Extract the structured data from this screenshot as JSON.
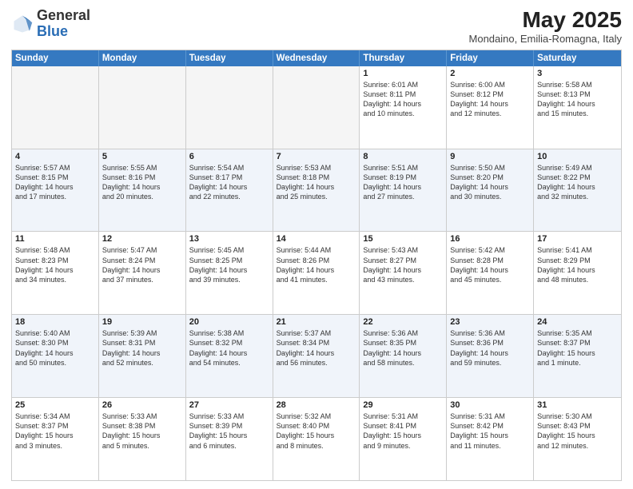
{
  "header": {
    "logo_general": "General",
    "logo_blue": "Blue",
    "month_title": "May 2025",
    "location": "Mondaino, Emilia-Romagna, Italy"
  },
  "days_of_week": [
    "Sunday",
    "Monday",
    "Tuesday",
    "Wednesday",
    "Thursday",
    "Friday",
    "Saturday"
  ],
  "rows": [
    {
      "alt": false,
      "cells": [
        {
          "day": "",
          "text": "",
          "empty": true
        },
        {
          "day": "",
          "text": "",
          "empty": true
        },
        {
          "day": "",
          "text": "",
          "empty": true
        },
        {
          "day": "",
          "text": "",
          "empty": true
        },
        {
          "day": "1",
          "text": "Sunrise: 6:01 AM\nSunset: 8:11 PM\nDaylight: 14 hours\nand 10 minutes.",
          "empty": false
        },
        {
          "day": "2",
          "text": "Sunrise: 6:00 AM\nSunset: 8:12 PM\nDaylight: 14 hours\nand 12 minutes.",
          "empty": false
        },
        {
          "day": "3",
          "text": "Sunrise: 5:58 AM\nSunset: 8:13 PM\nDaylight: 14 hours\nand 15 minutes.",
          "empty": false
        }
      ]
    },
    {
      "alt": true,
      "cells": [
        {
          "day": "4",
          "text": "Sunrise: 5:57 AM\nSunset: 8:15 PM\nDaylight: 14 hours\nand 17 minutes.",
          "empty": false
        },
        {
          "day": "5",
          "text": "Sunrise: 5:55 AM\nSunset: 8:16 PM\nDaylight: 14 hours\nand 20 minutes.",
          "empty": false
        },
        {
          "day": "6",
          "text": "Sunrise: 5:54 AM\nSunset: 8:17 PM\nDaylight: 14 hours\nand 22 minutes.",
          "empty": false
        },
        {
          "day": "7",
          "text": "Sunrise: 5:53 AM\nSunset: 8:18 PM\nDaylight: 14 hours\nand 25 minutes.",
          "empty": false
        },
        {
          "day": "8",
          "text": "Sunrise: 5:51 AM\nSunset: 8:19 PM\nDaylight: 14 hours\nand 27 minutes.",
          "empty": false
        },
        {
          "day": "9",
          "text": "Sunrise: 5:50 AM\nSunset: 8:20 PM\nDaylight: 14 hours\nand 30 minutes.",
          "empty": false
        },
        {
          "day": "10",
          "text": "Sunrise: 5:49 AM\nSunset: 8:22 PM\nDaylight: 14 hours\nand 32 minutes.",
          "empty": false
        }
      ]
    },
    {
      "alt": false,
      "cells": [
        {
          "day": "11",
          "text": "Sunrise: 5:48 AM\nSunset: 8:23 PM\nDaylight: 14 hours\nand 34 minutes.",
          "empty": false
        },
        {
          "day": "12",
          "text": "Sunrise: 5:47 AM\nSunset: 8:24 PM\nDaylight: 14 hours\nand 37 minutes.",
          "empty": false
        },
        {
          "day": "13",
          "text": "Sunrise: 5:45 AM\nSunset: 8:25 PM\nDaylight: 14 hours\nand 39 minutes.",
          "empty": false
        },
        {
          "day": "14",
          "text": "Sunrise: 5:44 AM\nSunset: 8:26 PM\nDaylight: 14 hours\nand 41 minutes.",
          "empty": false
        },
        {
          "day": "15",
          "text": "Sunrise: 5:43 AM\nSunset: 8:27 PM\nDaylight: 14 hours\nand 43 minutes.",
          "empty": false
        },
        {
          "day": "16",
          "text": "Sunrise: 5:42 AM\nSunset: 8:28 PM\nDaylight: 14 hours\nand 45 minutes.",
          "empty": false
        },
        {
          "day": "17",
          "text": "Sunrise: 5:41 AM\nSunset: 8:29 PM\nDaylight: 14 hours\nand 48 minutes.",
          "empty": false
        }
      ]
    },
    {
      "alt": true,
      "cells": [
        {
          "day": "18",
          "text": "Sunrise: 5:40 AM\nSunset: 8:30 PM\nDaylight: 14 hours\nand 50 minutes.",
          "empty": false
        },
        {
          "day": "19",
          "text": "Sunrise: 5:39 AM\nSunset: 8:31 PM\nDaylight: 14 hours\nand 52 minutes.",
          "empty": false
        },
        {
          "day": "20",
          "text": "Sunrise: 5:38 AM\nSunset: 8:32 PM\nDaylight: 14 hours\nand 54 minutes.",
          "empty": false
        },
        {
          "day": "21",
          "text": "Sunrise: 5:37 AM\nSunset: 8:34 PM\nDaylight: 14 hours\nand 56 minutes.",
          "empty": false
        },
        {
          "day": "22",
          "text": "Sunrise: 5:36 AM\nSunset: 8:35 PM\nDaylight: 14 hours\nand 58 minutes.",
          "empty": false
        },
        {
          "day": "23",
          "text": "Sunrise: 5:36 AM\nSunset: 8:36 PM\nDaylight: 14 hours\nand 59 minutes.",
          "empty": false
        },
        {
          "day": "24",
          "text": "Sunrise: 5:35 AM\nSunset: 8:37 PM\nDaylight: 15 hours\nand 1 minute.",
          "empty": false
        }
      ]
    },
    {
      "alt": false,
      "cells": [
        {
          "day": "25",
          "text": "Sunrise: 5:34 AM\nSunset: 8:37 PM\nDaylight: 15 hours\nand 3 minutes.",
          "empty": false
        },
        {
          "day": "26",
          "text": "Sunrise: 5:33 AM\nSunset: 8:38 PM\nDaylight: 15 hours\nand 5 minutes.",
          "empty": false
        },
        {
          "day": "27",
          "text": "Sunrise: 5:33 AM\nSunset: 8:39 PM\nDaylight: 15 hours\nand 6 minutes.",
          "empty": false
        },
        {
          "day": "28",
          "text": "Sunrise: 5:32 AM\nSunset: 8:40 PM\nDaylight: 15 hours\nand 8 minutes.",
          "empty": false
        },
        {
          "day": "29",
          "text": "Sunrise: 5:31 AM\nSunset: 8:41 PM\nDaylight: 15 hours\nand 9 minutes.",
          "empty": false
        },
        {
          "day": "30",
          "text": "Sunrise: 5:31 AM\nSunset: 8:42 PM\nDaylight: 15 hours\nand 11 minutes.",
          "empty": false
        },
        {
          "day": "31",
          "text": "Sunrise: 5:30 AM\nSunset: 8:43 PM\nDaylight: 15 hours\nand 12 minutes.",
          "empty": false
        }
      ]
    }
  ]
}
